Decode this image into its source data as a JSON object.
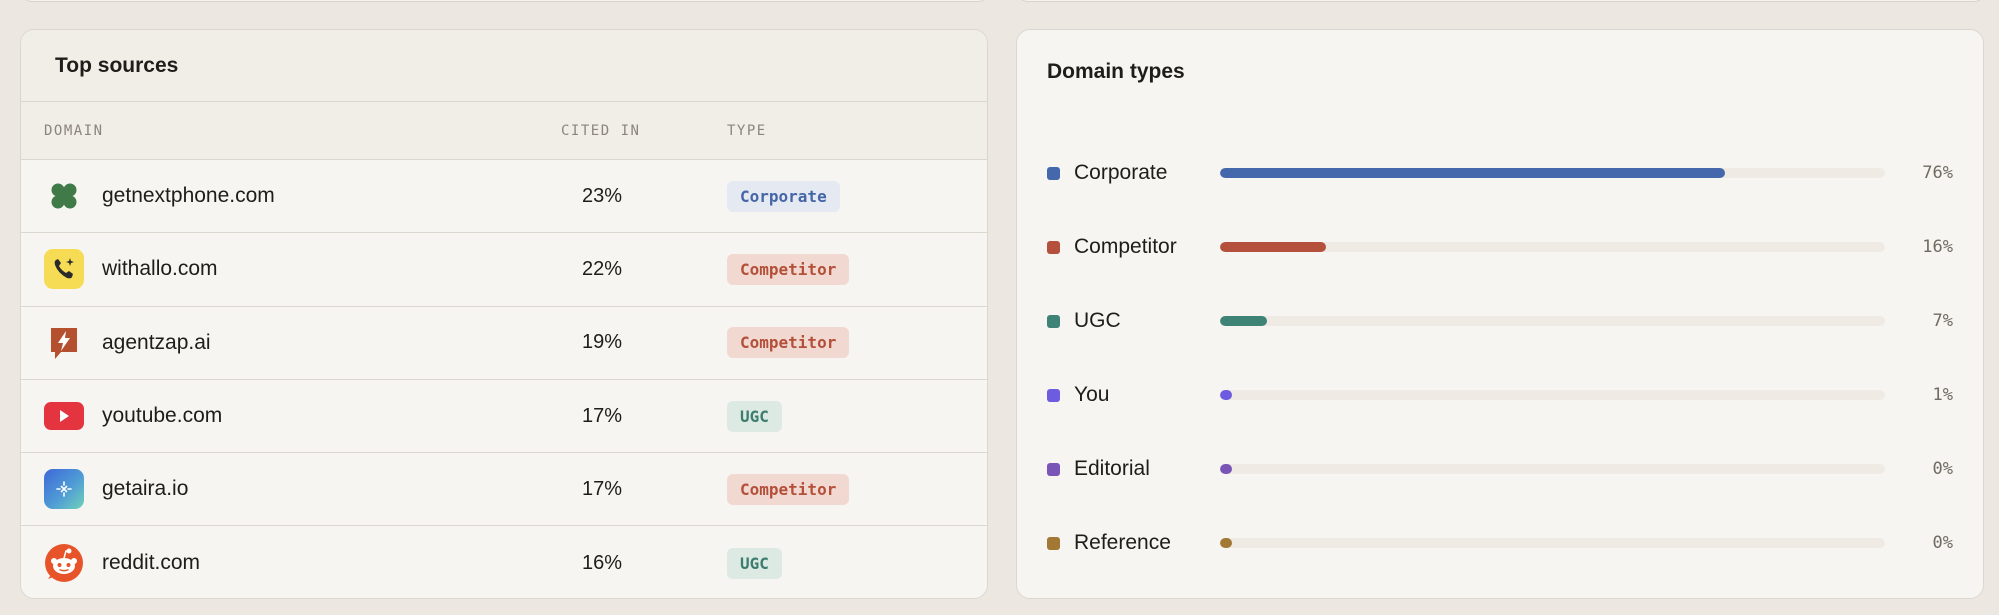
{
  "sources": {
    "title": "Top sources",
    "columns": {
      "domain": "DOMAIN",
      "cited": "CITED IN",
      "type": "TYPE"
    },
    "rows": [
      {
        "domain": "getnextphone.com",
        "cited": "23%",
        "type": "Corporate",
        "type_class": "corporate",
        "icon": "clover-icon"
      },
      {
        "domain": "withallo.com",
        "cited": "22%",
        "type": "Competitor",
        "type_class": "competitor",
        "icon": "phone-sparkle-icon"
      },
      {
        "domain": "agentzap.ai",
        "cited": "19%",
        "type": "Competitor",
        "type_class": "competitor",
        "icon": "lightning-bubble-icon"
      },
      {
        "domain": "youtube.com",
        "cited": "17%",
        "type": "UGC",
        "type_class": "ugc",
        "icon": "youtube-play-icon"
      },
      {
        "domain": "getaira.io",
        "cited": "17%",
        "type": "Competitor",
        "type_class": "competitor",
        "icon": "sparkle-square-icon"
      },
      {
        "domain": "reddit.com",
        "cited": "16%",
        "type": "UGC",
        "type_class": "ugc",
        "icon": "reddit-icon"
      }
    ]
  },
  "domain_types": {
    "title": "Domain types",
    "items": [
      {
        "label": "Corporate",
        "pct_label": "76%",
        "value": 76,
        "color": "#4568AD"
      },
      {
        "label": "Competitor",
        "pct_label": "16%",
        "value": 16,
        "color": "#B4503C"
      },
      {
        "label": "UGC",
        "pct_label": "7%",
        "value": 7,
        "color": "#3F8377"
      },
      {
        "label": "You",
        "pct_label": "1%",
        "value": 1,
        "color": "#6D5BE0"
      },
      {
        "label": "Editorial",
        "pct_label": "0%",
        "value": 0,
        "color": "#7A55B8"
      },
      {
        "label": "Reference",
        "pct_label": "0%",
        "value": 0,
        "color": "#A27834"
      }
    ]
  }
}
